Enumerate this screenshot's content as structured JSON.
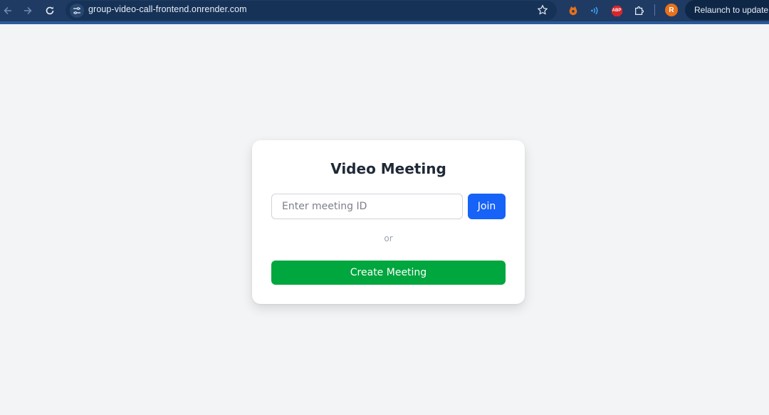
{
  "browser": {
    "url": "group-video-call-frontend.onrender.com",
    "profile_initial": "R",
    "relaunch_label": "Relaunch to update",
    "extensions": [
      "fox-extension-icon",
      "wifi-extension-icon",
      "adblock-plus-icon",
      "puzzle-extensions-icon"
    ],
    "adblock_label": "ABP"
  },
  "card": {
    "title": "Video Meeting",
    "meeting_input_placeholder": "Enter meeting ID",
    "meeting_input_value": "",
    "join_label": "Join",
    "or_label": "or",
    "create_label": "Create Meeting"
  },
  "colors": {
    "page_background": "#f3f4f6",
    "join_button": "#1762f7",
    "create_button": "#00a63e",
    "browser_toolbar": "#1f3b63",
    "avatar": "#e8711a"
  }
}
